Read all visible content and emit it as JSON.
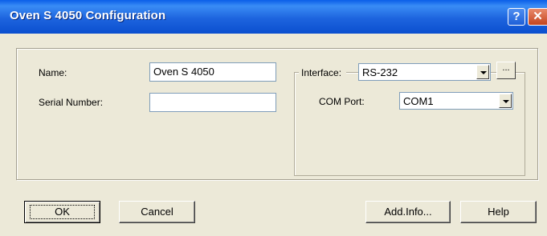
{
  "window": {
    "title": "Oven S 4050 Configuration"
  },
  "titlebar": {
    "help_glyph": "?",
    "close_glyph": "✕"
  },
  "form": {
    "name_label": "Name:",
    "name_value": "Oven S 4050",
    "serial_label": "Serial Number:",
    "serial_value": ""
  },
  "interface": {
    "label": "Interface:",
    "value": "RS-232",
    "browse_label": "...",
    "com_port_label": "COM Port:",
    "com_port_value": "COM1"
  },
  "buttons": {
    "ok": "OK",
    "cancel": "Cancel",
    "add_info": "Add.Info...",
    "help": "Help"
  },
  "icons": [
    "help-icon",
    "close-icon",
    "chevron-down-icon"
  ]
}
